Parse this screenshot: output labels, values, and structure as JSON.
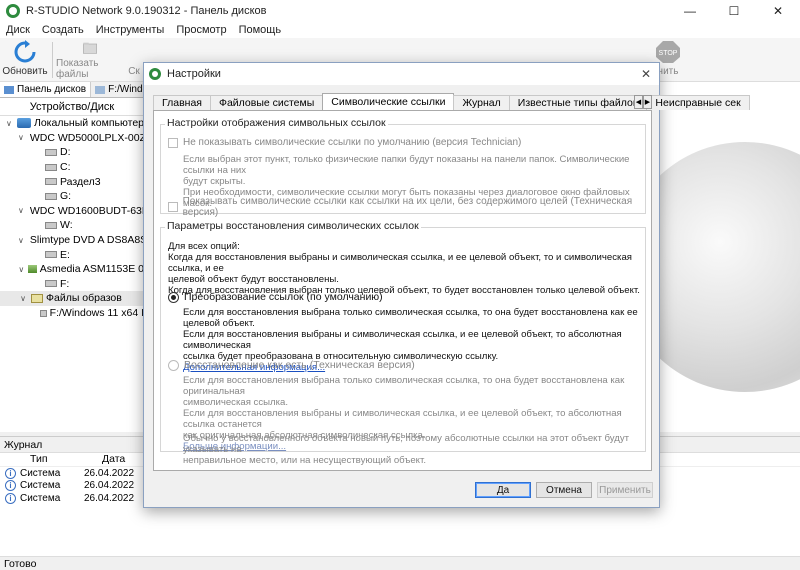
{
  "window": {
    "title": "R-STUDIO Network 9.0.190312 - Панель дисков"
  },
  "menu": [
    "Диск",
    "Создать",
    "Инструменты",
    "Просмотр",
    "Помощь"
  ],
  "toolbar": {
    "refresh": "Обновить",
    "show_files": "Показать файлы",
    "partial": "Ск",
    "stop": "Остановить",
    "stop_sign": "STOP",
    "partial_right": "нить"
  },
  "left_panel": {
    "tabs": [
      "Панель дисков",
      "F:/Windo"
    ],
    "column_header": "Устройство/Диск",
    "tree": [
      {
        "label": "Локальный компьютер",
        "icon": "computer-icon",
        "level": 0,
        "expanded": true
      },
      {
        "label": "WDC WD5000LPLX-00Z",
        "icon": "hdd-icon",
        "level": 1,
        "expanded": true
      },
      {
        "label": "D:",
        "icon": "partition-icon",
        "level": 2
      },
      {
        "label": "C:",
        "icon": "partition-icon",
        "level": 2
      },
      {
        "label": "Раздел3",
        "icon": "partition-icon",
        "level": 2
      },
      {
        "label": "G:",
        "icon": "partition-icon",
        "level": 2
      },
      {
        "label": "WDC WD1600BUDT-63D",
        "icon": "hdd-icon",
        "level": 1,
        "expanded": true
      },
      {
        "label": "W:",
        "icon": "partition-icon",
        "level": 2
      },
      {
        "label": "Slimtype DVD A DS8A8S",
        "icon": "dvd-icon",
        "level": 1,
        "expanded": true
      },
      {
        "label": "E:",
        "icon": "partition-icon",
        "level": 2
      },
      {
        "label": "Asmedia ASM1153E 0",
        "icon": "usb-drive-icon",
        "level": 1,
        "expanded": true
      },
      {
        "label": "F:",
        "icon": "partition-icon",
        "level": 2
      },
      {
        "label": "Файлы образов",
        "icon": "image-files-icon",
        "level": 1,
        "expanded": true,
        "selected": true
      },
      {
        "label": "F:/Windows 11 x64 I",
        "icon": "partition-icon",
        "level": 2
      }
    ]
  },
  "log": {
    "title": "Журнал",
    "columns": [
      "Тип",
      "Дата"
    ],
    "rows": [
      {
        "type": "Система",
        "date": "26.04.2022"
      },
      {
        "type": "Система",
        "date": "26.04.2022"
      },
      {
        "type": "Система",
        "date": "26.04.2022"
      }
    ]
  },
  "status": "Готово",
  "dialog": {
    "title": "Настройки",
    "tabs": [
      "Главная",
      "Файловые системы",
      "Символические ссылки",
      "Журнал",
      "Известные типы файлов",
      "Неисправные сек"
    ],
    "active_tab": 2,
    "group1": {
      "title": "Настройки отображения символьных ссылок",
      "cb1_label": "Не показывать символические ссылки по умолчанию (версия Technician)",
      "cb1_desc1": "Если выбран этот пункт, только физические папки будут показаны на панели папок. Символические ссылки на них",
      "cb1_desc2": "будут скрыты.",
      "cb1_desc3": "При необходимости, символические ссылки могут быть показаны через диалоговое окно файловых масок.",
      "cb2_label": "Показывать символические ссылки как ссылки на их цели, без содержимого целей (Техническая версия)"
    },
    "group2": {
      "title": "Параметры восстановления символических ссылок",
      "intro1": "Для всех опций:",
      "intro2": "Когда для восстановления выбраны и символическая ссылка, и ее целевой объект, то и символическая ссылка, и ее",
      "intro3": "целевой объект будут восстановлены.",
      "intro4": "Когда для восстановления выбран только целевой объект, то будет восстановлен только целевой объект.",
      "radio1_label": "Преобразование ссылок (по умолчанию)",
      "radio1_desc1": "Если для восстановления выбрана только символическая ссылка, то она будет восстановлена как ее целевой объект.",
      "radio1_desc2": "Если для восстановления выбраны и символическая ссылка, и ее целевой объект, то абсолютная символическая",
      "radio1_desc3": "ссылка будет преобразована в относительную символическую ссылку.",
      "radio1_link": "Дополнительная информация...",
      "radio2_label": "Восстановление как есть (Техническая версия)",
      "radio2_desc1": "Если для восстановления выбрана только символическая ссылка, то она будет восстановлена как оригинальная",
      "radio2_desc2": "символическая ссылка.",
      "radio2_desc3": "Если для восстановления выбраны и символическая ссылка, и ее целевой объект, то абсолютная ссылка останется",
      "radio2_desc4": "как оригинальная абсолютная символическая ссылка.",
      "radio2_link": "Больше информации...",
      "note1": "Обычно у восстановленного объекта новый путь, поэтому абсолютные ссылки на этот объект будут указывать на",
      "note2": "неправильное место, или на несуществующий объект."
    },
    "buttons": {
      "ok": "Да",
      "cancel": "Отмена",
      "apply": "Применить"
    }
  }
}
